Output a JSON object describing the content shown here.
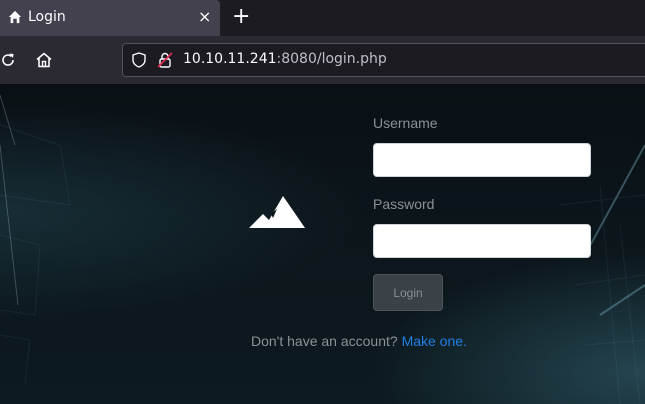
{
  "browser": {
    "tab": {
      "title": "Login",
      "icon": "home-icon",
      "close_label": "×"
    },
    "new_tab_label": "+",
    "url": {
      "host": "10.10.11.241",
      "rest": ":8080/login.php"
    }
  },
  "login": {
    "username_label": "Username",
    "username_value": "",
    "password_label": "Password",
    "password_value": "",
    "submit_label": "Login",
    "signup_prompt": "Don't have an account?",
    "signup_link": "Make one",
    "signup_suffix": "."
  },
  "colors": {
    "accent_link": "#1f7fe5",
    "page_background": "#0b1218"
  }
}
